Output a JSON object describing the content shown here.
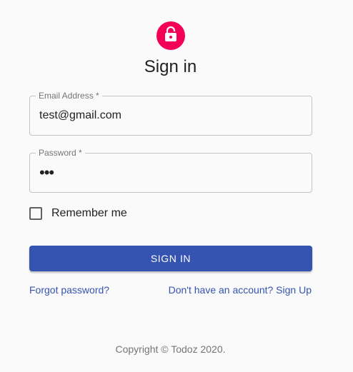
{
  "header": {
    "icon": "lock-open-icon",
    "title": "Sign in",
    "accent_color": "#f50057"
  },
  "form": {
    "email": {
      "label": "Email Address *",
      "value": "test@gmail.com"
    },
    "password": {
      "label": "Password *",
      "value": "•••"
    },
    "remember": {
      "label": "Remember me",
      "checked": false
    },
    "submit_label": "SIGN IN",
    "primary_color": "#3553b1"
  },
  "links": {
    "forgot": "Forgot password?",
    "signup": "Don't have an account? Sign Up"
  },
  "footer": {
    "copyright": "Copyright © Todoz 2020."
  }
}
